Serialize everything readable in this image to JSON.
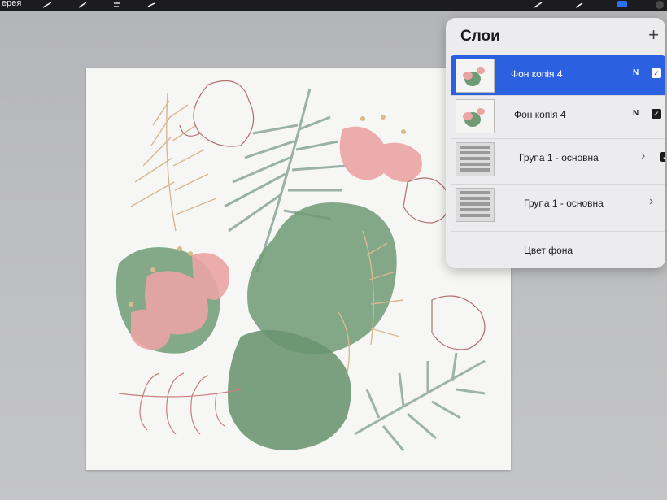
{
  "toolbar": {
    "gallery_label": "ерея",
    "active_color": "#2d6ff2"
  },
  "layers_panel": {
    "title": "Слои",
    "add_icon": "+",
    "rows": [
      {
        "name": "Фон копія 4",
        "mode": "N",
        "visible": true,
        "selected": true
      },
      {
        "name": "Фон копія 4",
        "mode": "N",
        "visible": true,
        "selected": false
      },
      {
        "name": "Група 1 - основна",
        "chevron": "›",
        "visible": true
      },
      {
        "name": "Група 1 - основна",
        "chevron": "›"
      },
      {
        "name": "Цвет фона"
      }
    ],
    "check_icon": "✓",
    "colors": {
      "selected": "#2b60e0",
      "panel": "#ececee"
    }
  },
  "canvas": {
    "colors": {
      "leaf": "#5f8f6a",
      "flower": "#eaa8a8",
      "gold": "#d4b08a",
      "outline": "#b06a6a"
    }
  }
}
